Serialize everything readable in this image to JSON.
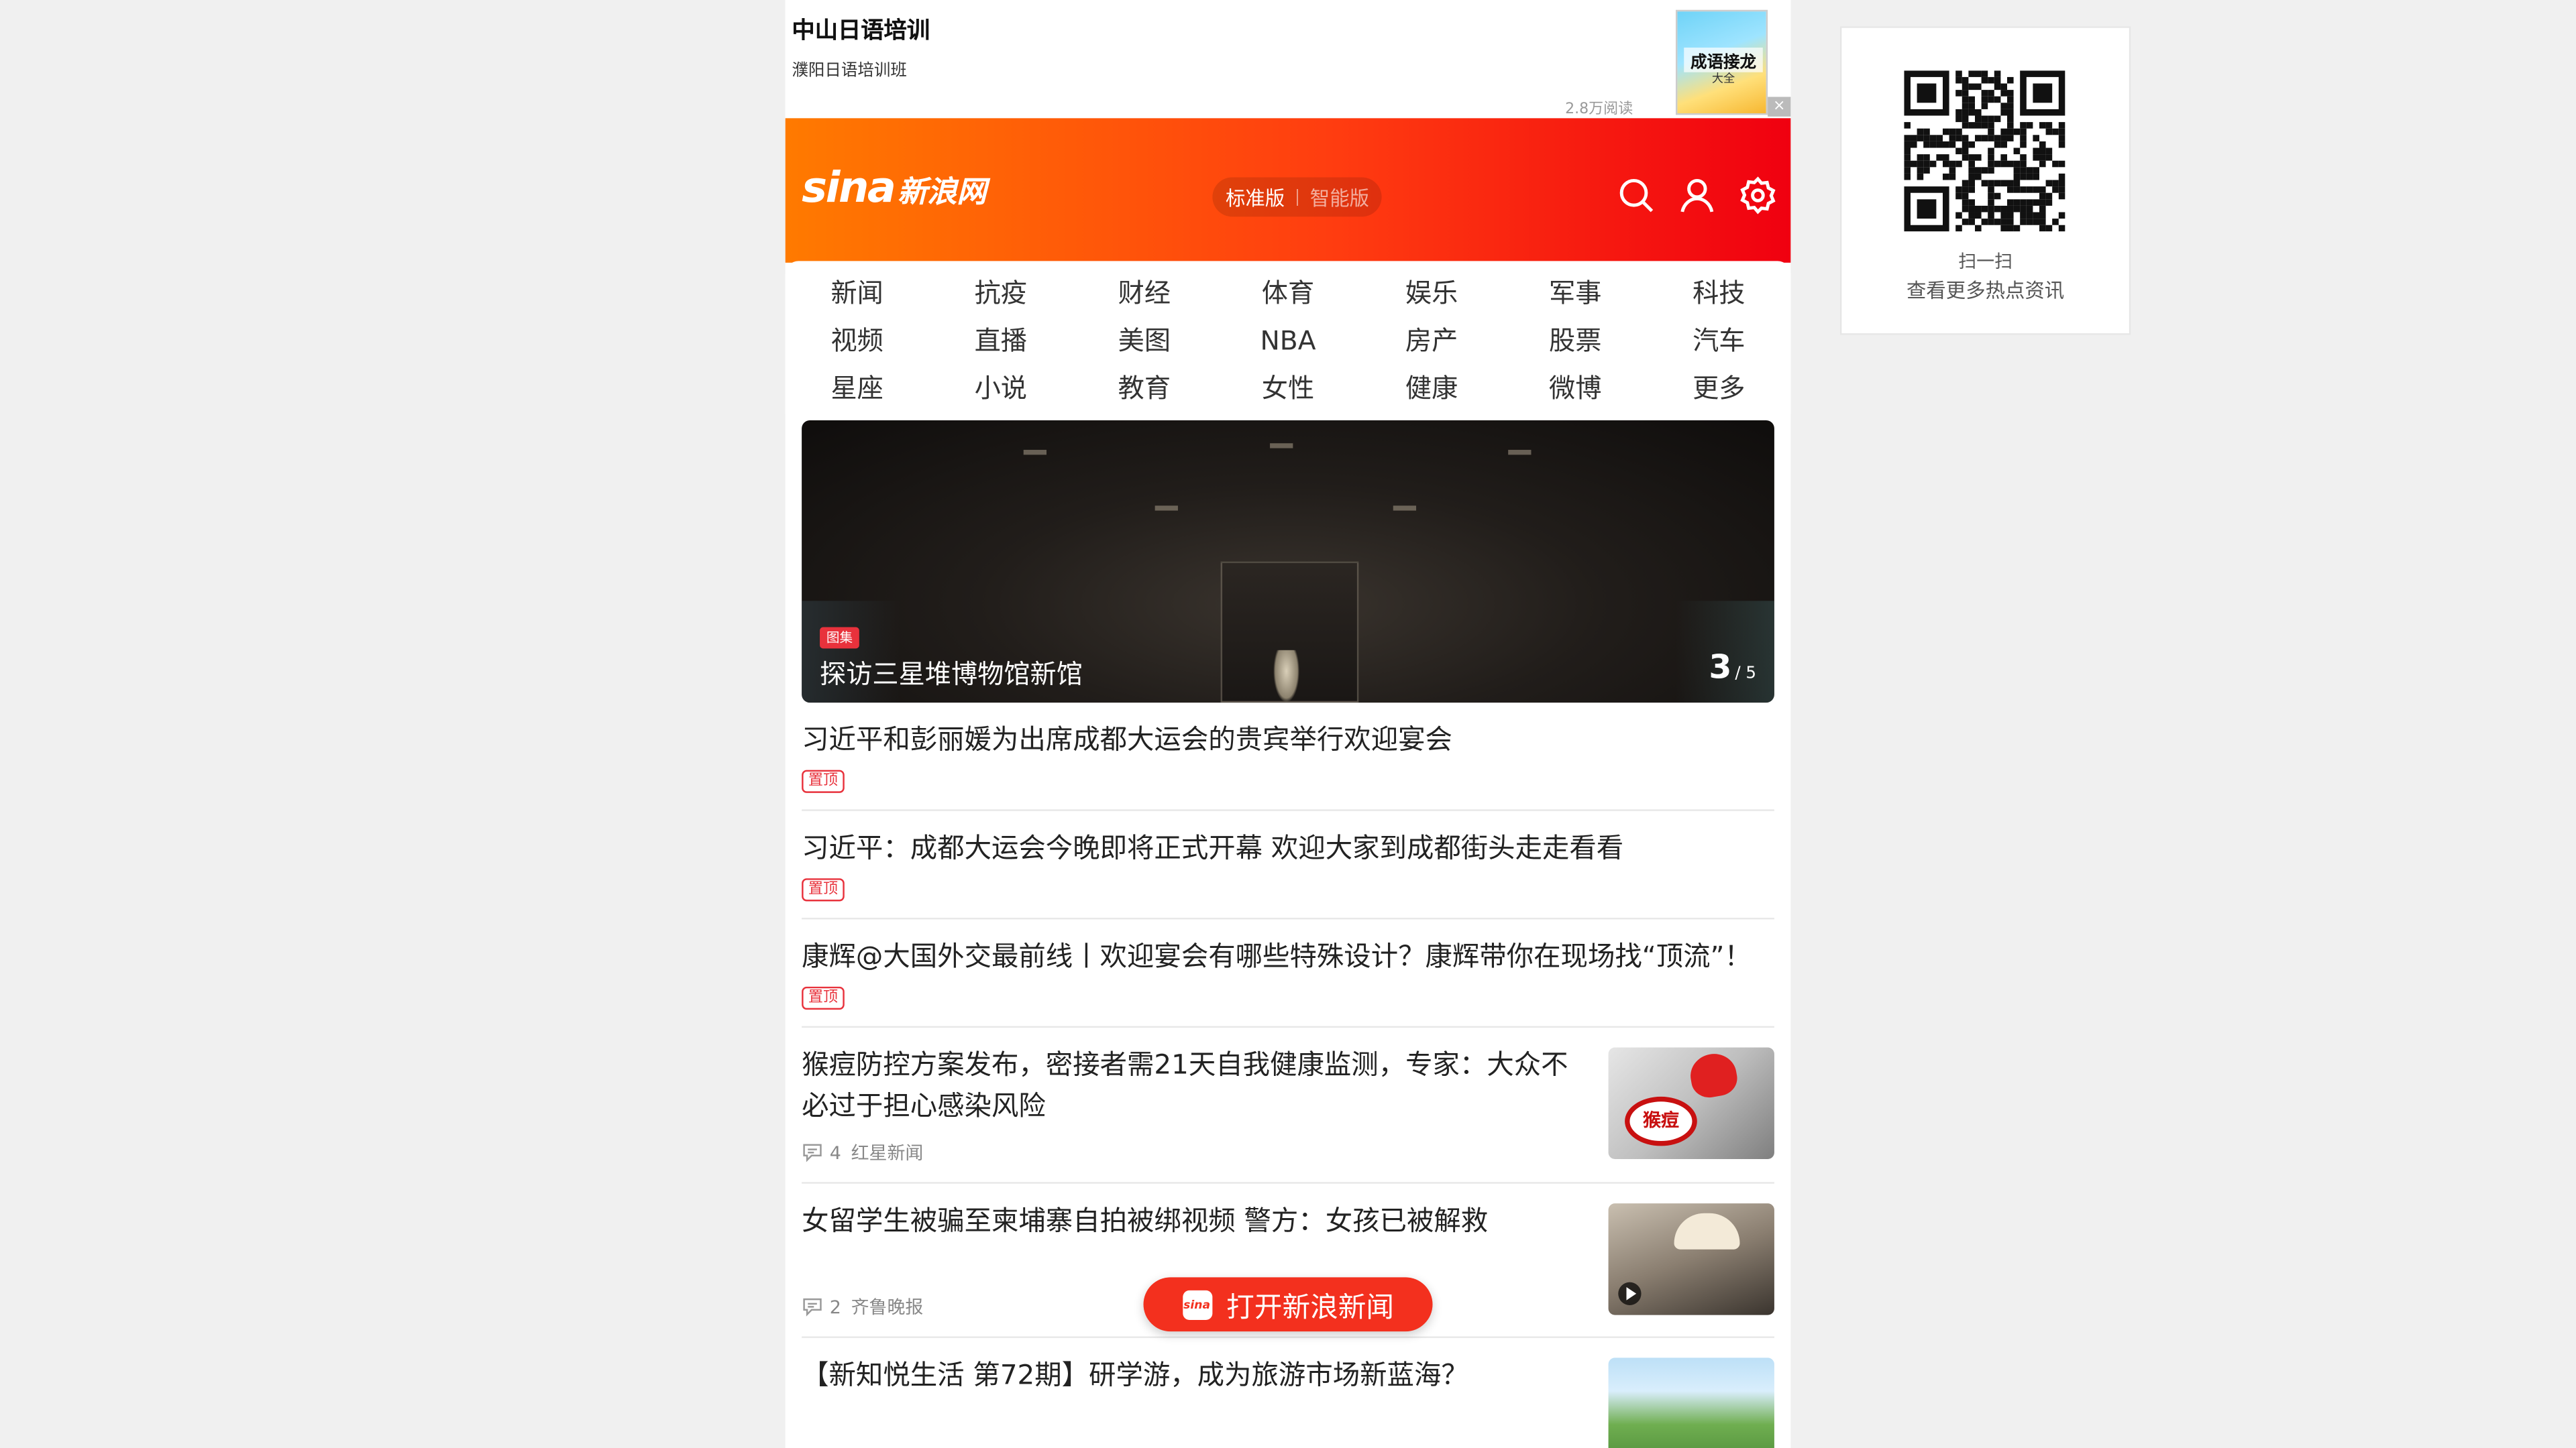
{
  "ad": {
    "title": "中山日语培训",
    "subtitle": "濮阳日语培训班",
    "reads": "2.8万阅读",
    "thumb_title": "成语接龙",
    "thumb_sub": "大全",
    "close": "×"
  },
  "header": {
    "logo_latin": "sina",
    "logo_cn": "新浪网",
    "version_active": "标准版",
    "version_inactive": "智能版",
    "separator": "|",
    "bg_start": "#ff7a00",
    "bg_end": "#f00010"
  },
  "nav": {
    "items": [
      "新闻",
      "抗疫",
      "财经",
      "体育",
      "娱乐",
      "军事",
      "科技",
      "视频",
      "直播",
      "美图",
      "NBA",
      "房产",
      "股票",
      "汽车",
      "星座",
      "小说",
      "教育",
      "女性",
      "健康",
      "微博",
      "更多"
    ]
  },
  "slider": {
    "tag": "图集",
    "title": "探访三星堆博物馆新馆",
    "current": "3",
    "total": "/ 5"
  },
  "news": {
    "pinned": [
      {
        "headline": "习近平和彭丽媛为出席成都大运会的贵宾举行欢迎宴会",
        "badge": "置顶"
      },
      {
        "headline": "习近平：成都大运会今晚即将正式开幕 欢迎大家到成都街头走走看看",
        "badge": "置顶"
      },
      {
        "headline": "康辉@大国外交最前线丨欢迎宴会有哪些特殊设计？康辉带你在现场找“顶流”！",
        "badge": "置顶"
      }
    ],
    "items": [
      {
        "headline": "猴痘防控方案发布，密接者需21天自我健康监测，专家：大众不必过于担心感染风险",
        "comments": "4",
        "source": "红星新闻",
        "thumb_label": "猴痘"
      },
      {
        "headline": "女留学生被骗至柬埔寨自拍被绑视频 警方：女孩已被解救",
        "comments": "2",
        "source": "齐鲁晚报"
      },
      {
        "headline": "【新知悦生活 第72期】研学游，成为旅游市场新蓝海？"
      }
    ]
  },
  "open_app": {
    "label": "打开新浪新闻",
    "icon_text": "sina",
    "color": "#f3301e"
  },
  "qr": {
    "line1": "扫一扫",
    "line2": "查看更多热点资讯"
  },
  "accent": "#e8323c"
}
